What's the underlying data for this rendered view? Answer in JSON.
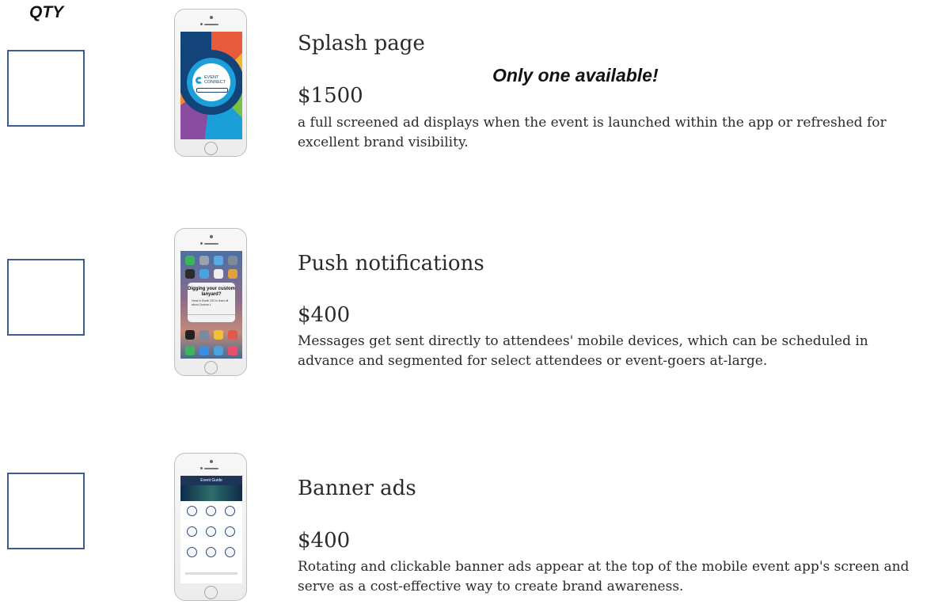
{
  "header": {
    "qty_label": "QTY"
  },
  "products": [
    {
      "title": "Splash page",
      "price": "$1500",
      "description": "a full screened ad displays when the event is launched within the app or refreshed for excellent brand visibility.",
      "note": "Only one available!",
      "screen": {
        "logo_line1": "EVENT",
        "logo_line2": "CONNECT"
      }
    },
    {
      "title": "Push notifications",
      "price": "$400",
      "description": "Messages get sent directly to attendees' mobile devices, which can be scheduled in advance and segmented for select attendees or event-goers at-large.",
      "screen": {
        "alert_title": "Digging your custom lanyard?",
        "alert_body": "Head to Booth 232 to learn all about Custom L"
      }
    },
    {
      "title": "Banner ads",
      "price": "$400",
      "description": "Rotating and clickable banner ads appear at the top of the mobile event app's screen and serve as a cost-effective way to create brand awareness.",
      "screen": {
        "bar_title": "Event Guide"
      }
    }
  ],
  "colors": {
    "qty_border": "#3b5c90",
    "text": "#2a2a2a"
  }
}
